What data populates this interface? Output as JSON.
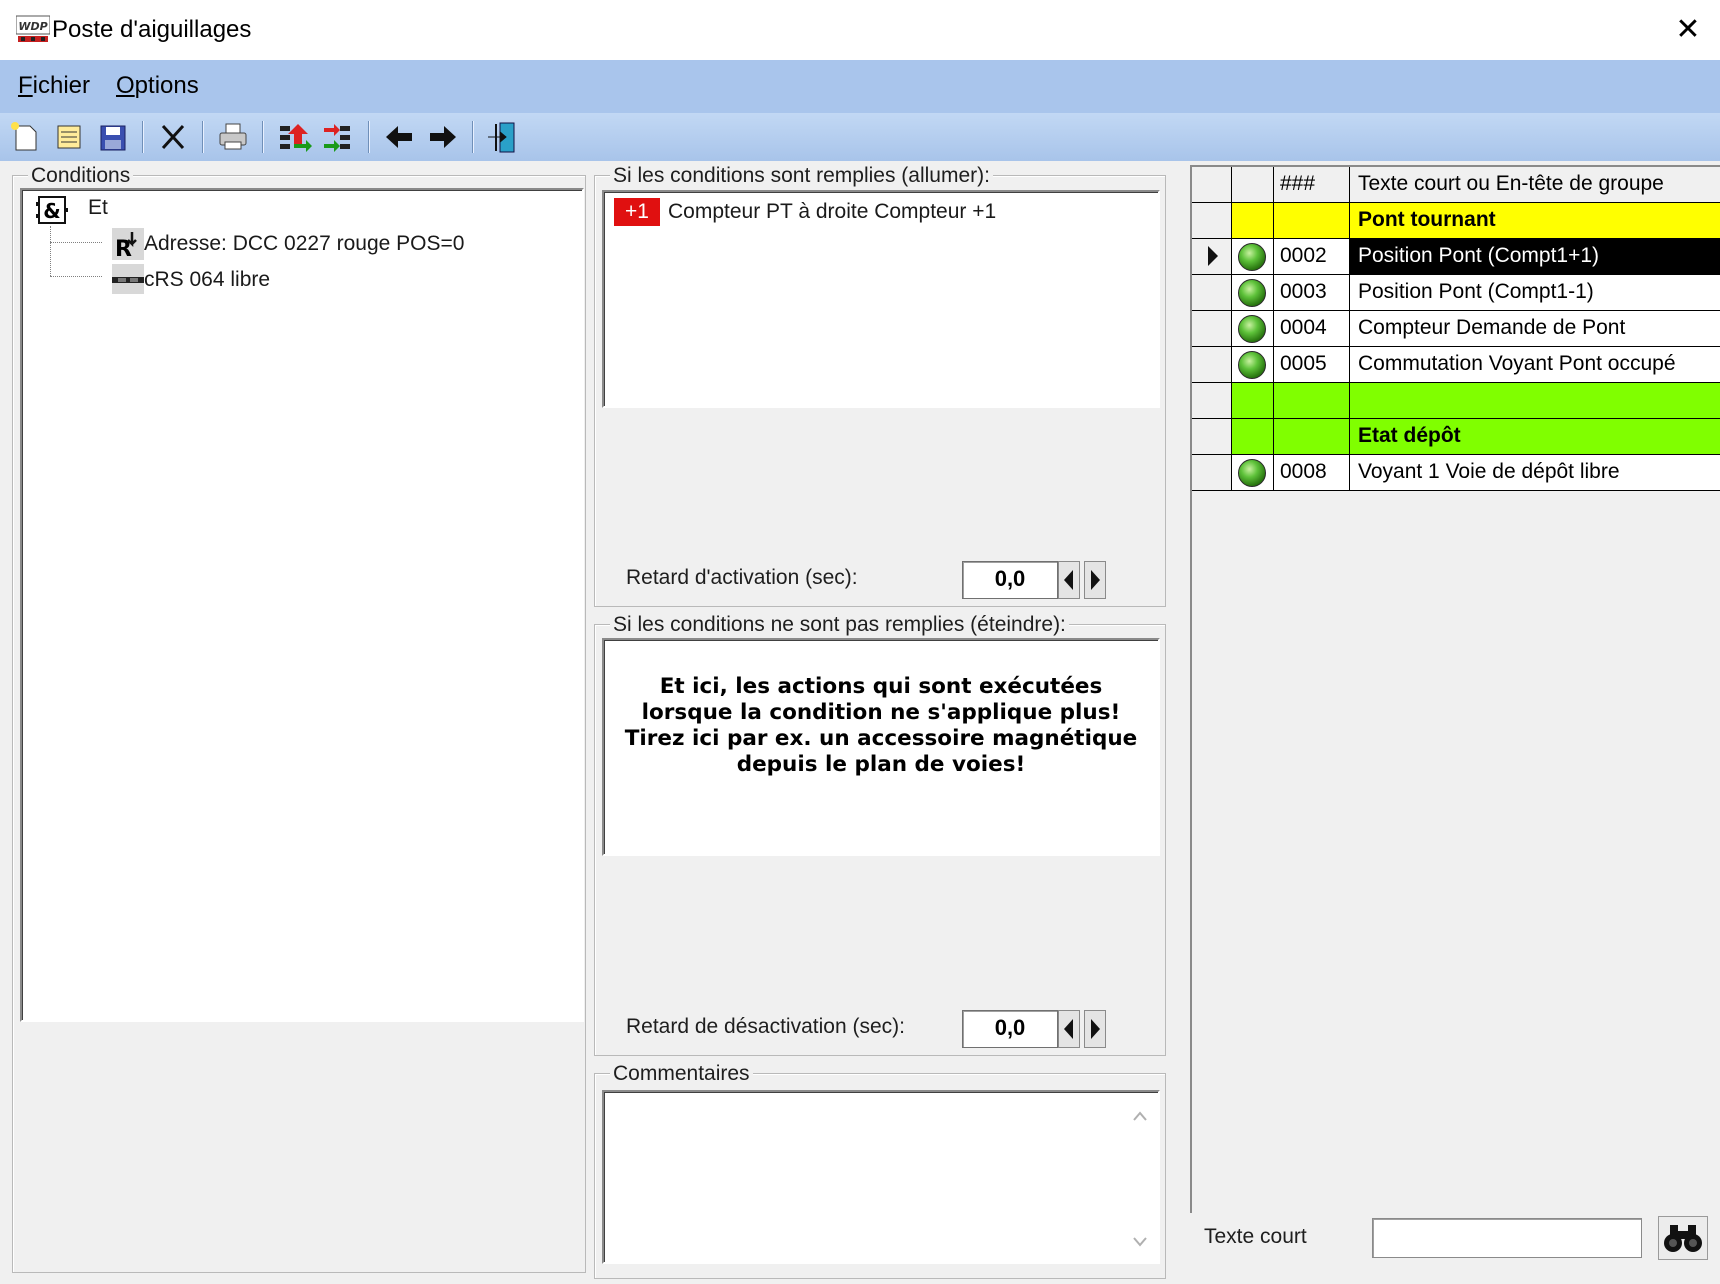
{
  "window": {
    "title": "Poste d'aiguillages",
    "close_glyph": "✕",
    "logo_text": "WDP"
  },
  "menu": {
    "items": [
      {
        "first": "F",
        "rest": "ichier"
      },
      {
        "first": "O",
        "rest": "ptions"
      }
    ]
  },
  "toolbar": {
    "buttons": [
      "new-icon",
      "open-icon",
      "save-icon",
      "delete-icon",
      "print-icon",
      "import-icon",
      "export-icon",
      "arrow-left-icon",
      "arrow-right-icon",
      "exit-icon"
    ]
  },
  "conditions": {
    "title": "Conditions",
    "root": {
      "icon": "&",
      "label": "Et"
    },
    "items": [
      {
        "icon": "route-icon",
        "label": "Adresse: DCC 0227 rouge POS=0"
      },
      {
        "icon": "feedback-icon",
        "label": "cRS 064 libre"
      }
    ]
  },
  "on_panel": {
    "title": "Si les conditions sont remplies (allumer):",
    "actions": [
      {
        "badge": "+1",
        "label": "Compteur PT à droite Compteur +1"
      }
    ],
    "delay_label": "Retard d'activation (sec):",
    "delay_value": "0,0"
  },
  "off_panel": {
    "title": "Si les conditions ne sont pas remplies (éteindre):",
    "hint": "Et ici, les actions qui sont exécutées lorsque la condition ne s'applique plus! Tirez ici par ex. un accessoire magnétique depuis le plan de voies!",
    "delay_label": "Retard de désactivation (sec):",
    "delay_value": "0,0"
  },
  "comments": {
    "title": "Commentaires",
    "value": ""
  },
  "grid": {
    "headers": {
      "num": "###",
      "text": "Texte court ou En-tête de groupe"
    },
    "rows": [
      {
        "type": "group",
        "color": "#ffff00",
        "num": "",
        "text": "Pont tournant"
      },
      {
        "type": "item",
        "num": "0002",
        "text": "Position Pont (Compt1+1)",
        "selected": true
      },
      {
        "type": "item",
        "num": "0003",
        "text": "Position Pont (Compt1-1)"
      },
      {
        "type": "item",
        "num": "0004",
        "text": "Compteur Demande de Pont"
      },
      {
        "type": "item",
        "num": "0005",
        "text": "Commutation Voyant Pont occupé"
      },
      {
        "type": "group",
        "color": "#80ff00",
        "num": "",
        "text": ""
      },
      {
        "type": "group",
        "color": "#80ff00",
        "num": "",
        "text": "Etat dépôt"
      },
      {
        "type": "item",
        "num": "0008",
        "text": "Voyant  1 Voie de dépôt libre"
      }
    ]
  },
  "search": {
    "label": "Texte court",
    "value": ""
  }
}
